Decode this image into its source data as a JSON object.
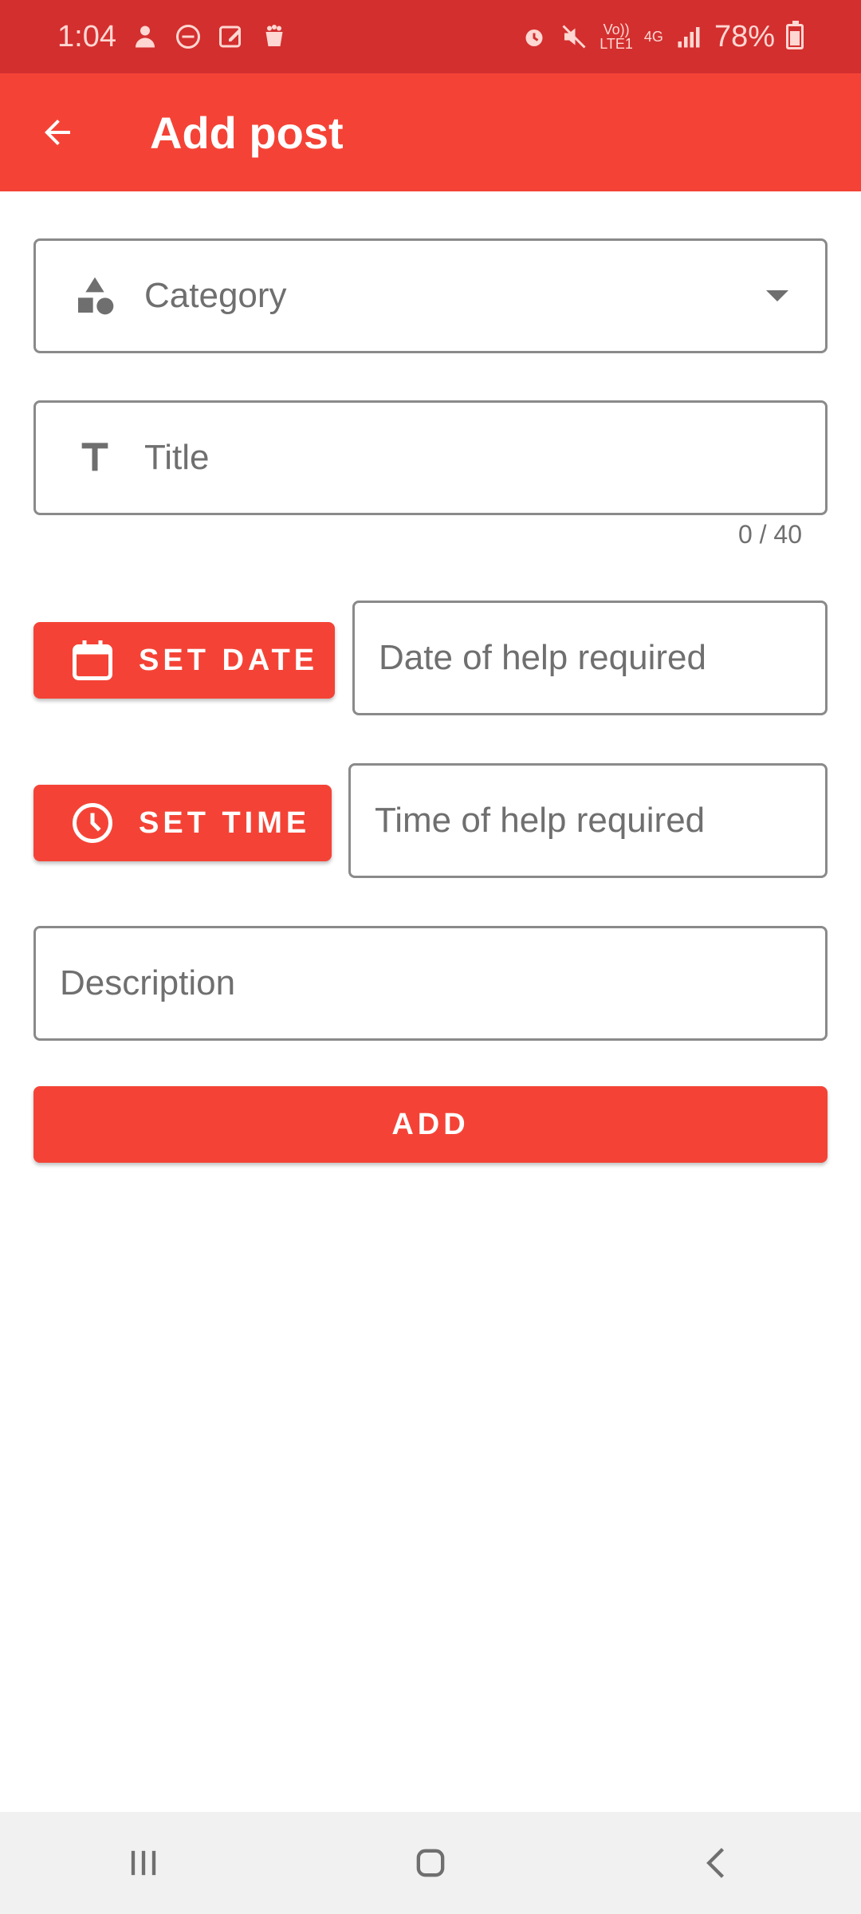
{
  "status_bar": {
    "time": "1:04",
    "network_top": "Vo))",
    "network_bottom": "LTE1",
    "network_type": "4G",
    "battery": "78%",
    "icons": [
      "person-icon",
      "do-not-disturb-icon",
      "edit-note-icon",
      "app-icon",
      "alarm-icon",
      "mute-icon",
      "signal-icon",
      "battery-charging-icon"
    ]
  },
  "app_bar": {
    "title": "Add post",
    "back_icon": "arrow-back-icon"
  },
  "form": {
    "category": {
      "placeholder": "Category",
      "icon": "shapes-icon"
    },
    "title": {
      "placeholder": "Title",
      "icon": "title-icon",
      "counter": "0 / 40"
    },
    "set_date_button": "SET DATE",
    "date_field": "Date of help required",
    "set_time_button": "SET TIME",
    "time_field": "Time of help required",
    "description": "Description",
    "add_button": "ADD"
  },
  "colors": {
    "status_bar": "#d32f2f",
    "primary": "#f44336",
    "field_border": "#8a8a8a",
    "hint_text": "#6f6f6f"
  },
  "nav_bar": {
    "items": [
      "recent-apps-icon",
      "home-icon",
      "back-icon"
    ]
  }
}
